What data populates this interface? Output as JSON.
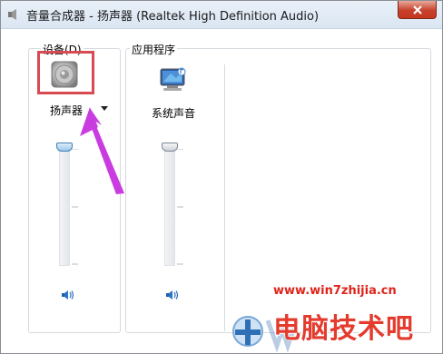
{
  "window": {
    "title": "音量合成器 - 扬声器 (Realtek High Definition Audio)"
  },
  "groups": {
    "device_label": "设备(D)",
    "apps_label": "应用程序"
  },
  "device": {
    "name": "扬声器",
    "icon": "speaker-icon",
    "volume_level": 1.0
  },
  "apps": [
    {
      "name": "系统声音",
      "icon": "system-sounds-icon",
      "volume_level": 1.0
    }
  ],
  "watermark": {
    "url": "www.win7zhijia.cn",
    "text": "电脑技术吧"
  },
  "colors": {
    "highlight": "#d84b53",
    "arrow": "#c93ce0",
    "watermark": "#e0241b"
  }
}
